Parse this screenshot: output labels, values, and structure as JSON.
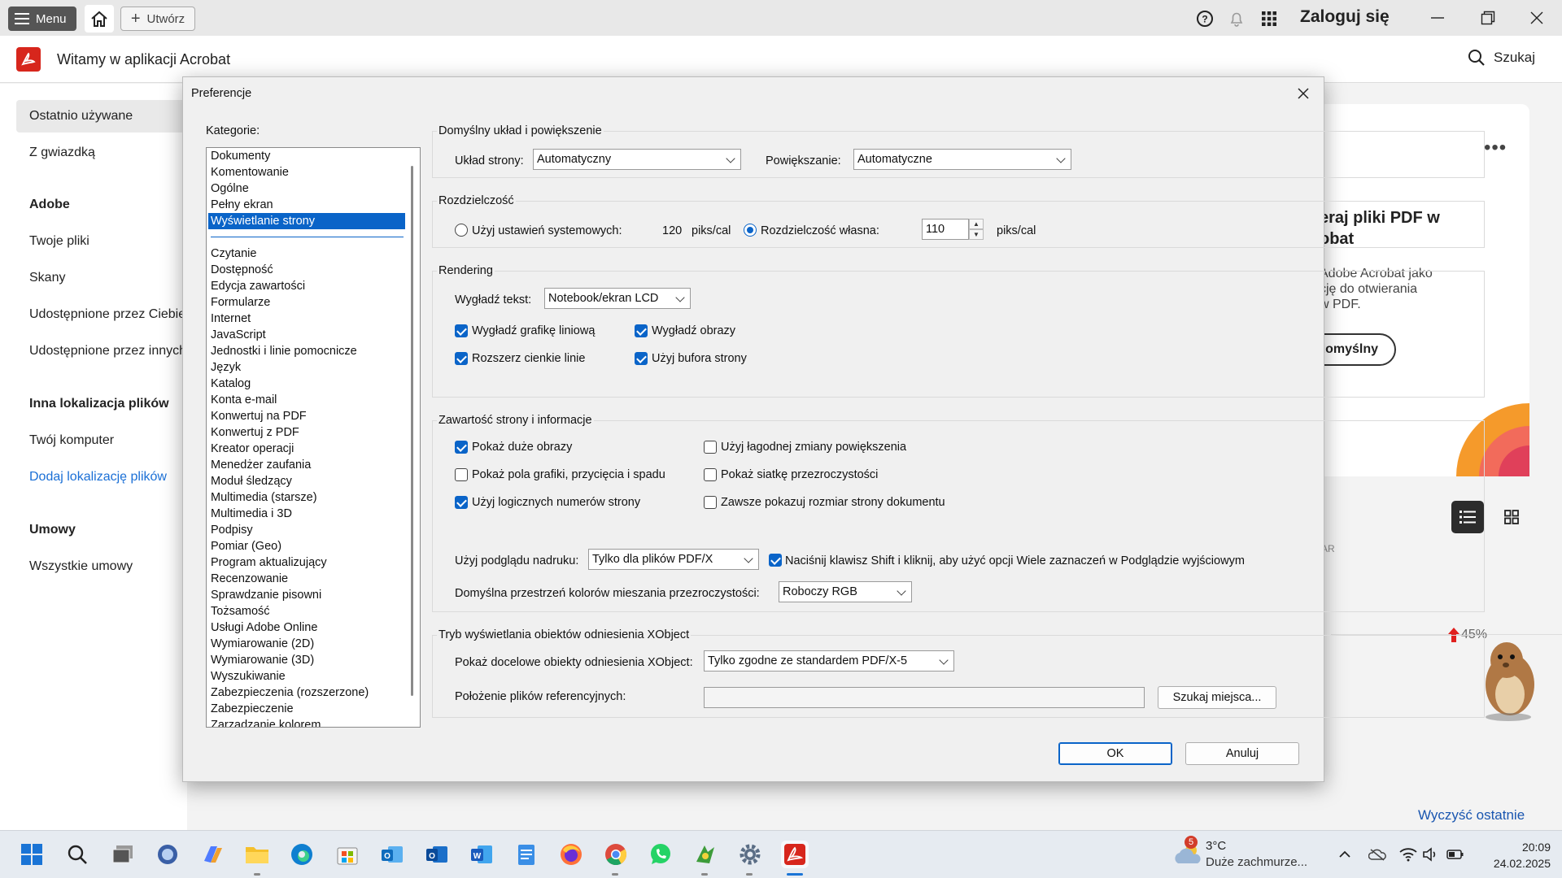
{
  "titlebar": {
    "menu_label": "Menu",
    "create_label": "Utwórz",
    "login_label": "Zaloguj się"
  },
  "appbar": {
    "title": "Witamy w aplikacji Acrobat",
    "search_label": "Szukaj"
  },
  "sidebar": {
    "recent": "Ostatnio używane",
    "starred": "Z gwiazdką",
    "adobe_heading": "Adobe",
    "your_files": "Twoje pliki",
    "scans": "Skany",
    "shared_by_you": "Udostępnione przez Ciebie",
    "shared_by_others": "Udostępnione przez innych",
    "other_heading": "Inna lokalizacja plików",
    "your_computer": "Twój komputer",
    "add_location": "Dodaj lokalizację plików",
    "agreements_heading": "Umowy",
    "all_agreements": "Wszystkie umowy"
  },
  "background": {
    "promo_title_line1": "eraj pliki PDF w",
    "promo_title_line2": "obat",
    "promo_text_line1": "Adobe Acrobat jako",
    "promo_text_line2": "cję do otwierania",
    "promo_text_line3": "w PDF.",
    "promo_button": "domyślny",
    "column_label": "AR",
    "percent": "45%",
    "clear_recent": "Wyczyść ostatnie"
  },
  "dialog": {
    "title": "Preferencje",
    "categories_label": "Kategorie:",
    "categories_top": [
      "Dokumenty",
      "Komentowanie",
      "Ogólne",
      "Pełny ekran",
      "Wyświetlanie strony"
    ],
    "categories_rest": [
      "Czytanie",
      "Dostępność",
      "Edycja zawartości",
      "Formularze",
      "Internet",
      "JavaScript",
      "Jednostki i linie pomocnicze",
      "Język",
      "Katalog",
      "Konta e-mail",
      "Konwertuj na PDF",
      "Konwertuj z PDF",
      "Kreator operacji",
      "Menedżer zaufania",
      "Moduł śledzący",
      "Multimedia (starsze)",
      "Multimedia i 3D",
      "Podpisy",
      "Pomiar (Geo)",
      "Program aktualizujący",
      "Recenzowanie",
      "Sprawdzanie pisowni",
      "Tożsamość",
      "Usługi Adobe Online",
      "Wymiarowanie (2D)",
      "Wymiarowanie (3D)",
      "Wyszukiwanie",
      "Zabezpieczenia (rozszerzone)",
      "Zabezpieczenie",
      "Zarządzanie kolorem"
    ],
    "layout_group": "Domyślny układ i powiększenie",
    "page_layout_label": "Układ strony:",
    "page_layout_value": "Automatyczny",
    "zoom_label": "Powiększanie:",
    "zoom_value": "Automatyczne",
    "resolution_group": "Rozdzielczość",
    "use_system_label": "Użyj ustawień systemowych:",
    "system_value": "120",
    "unit": "piks/cal",
    "custom_label": "Rozdzielczość własna:",
    "custom_value": "110",
    "rendering_group": "Rendering",
    "smooth_text_label": "Wygładź tekst:",
    "smooth_text_value": "Notebook/ekran LCD",
    "smooth_line_art": "Wygładź grafikę liniową",
    "smooth_images": "Wygładź obrazy",
    "enhance_thin_lines": "Rozszerz cienkie linie",
    "use_page_cache": "Użyj bufora strony",
    "content_group": "Zawartość strony i informacje",
    "show_large_images": "Pokaż duże obrazy",
    "smooth_zoom": "Użyj łagodnej zmiany powiększenia",
    "show_art_trim_bleed": "Pokaż pola grafiki, przycięcia i spadu",
    "show_transparency_grid": "Pokaż siatkę przezroczystości",
    "logical_page_numbers": "Użyj logicznych numerów strony",
    "always_show_size": "Zawsze pokazuj rozmiar strony dokumentu",
    "overprint_label": "Użyj podglądu nadruku:",
    "overprint_value": "Tylko dla plików PDF/X",
    "shift_click_text": "Naciśnij klawisz Shift i kliknij, aby użyć opcji Wiele zaznaczeń w Podglądzie wyjściowym",
    "blend_space_label": "Domyślna przestrzeń kolorów mieszania przezroczystości:",
    "blend_space_value": "Roboczy RGB",
    "xobject_group": "Tryb wyświetlania obiektów odniesienia XObject",
    "show_xobject_label": "Pokaż docelowe obiekty odniesienia XObject:",
    "show_xobject_value": "Tylko zgodne ze standardem PDF/X-5",
    "ref_location_label": "Położenie plików referencyjnych:",
    "browse_button": "Szukaj miejsca...",
    "ok_button": "OK",
    "cancel_button": "Anuluj"
  },
  "taskbar": {
    "weather_badge": "5",
    "weather_temp": "3°C",
    "weather_desc": "Duże zachmurze...",
    "time": "20:09",
    "date": "24.02.2025"
  }
}
